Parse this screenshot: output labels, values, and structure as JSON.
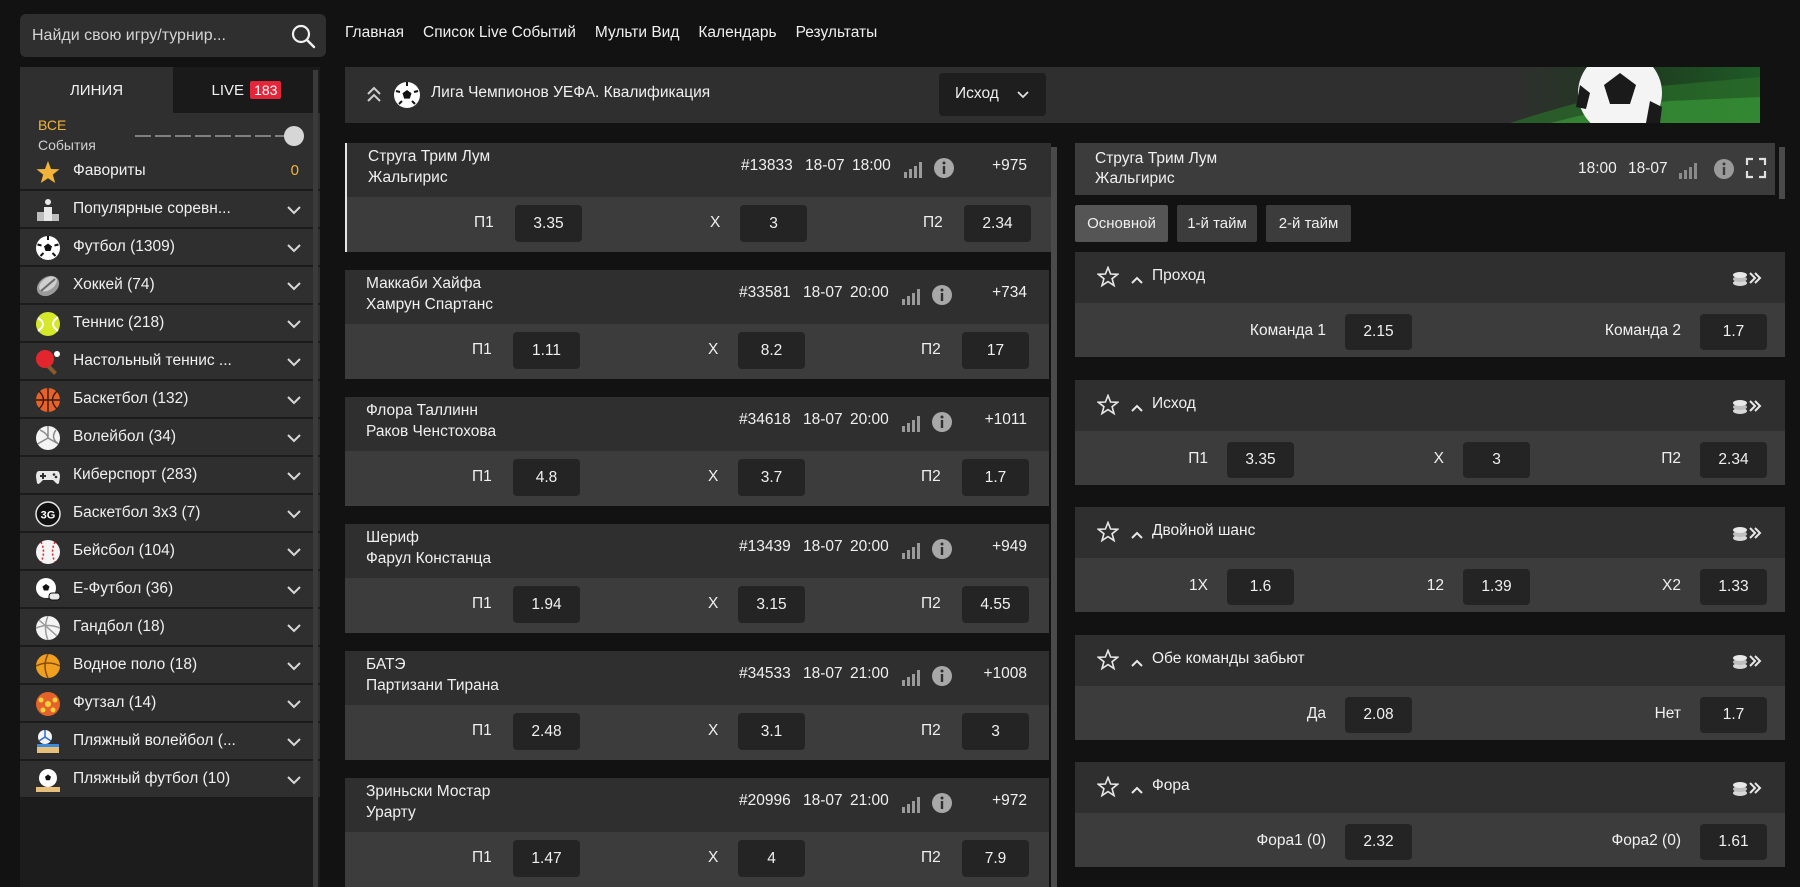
{
  "search": {
    "placeholder": "Найди свою игру/турнир..."
  },
  "topnav": [
    "Главная",
    "Список Live Событий",
    "Мульти Вид",
    "Календарь",
    "Результаты"
  ],
  "sidebar": {
    "tab_line": "ЛИНИЯ",
    "tab_live": "LIVE",
    "live_count": "183",
    "all_label": "ВСЕ",
    "events_label": "События",
    "items": [
      {
        "label": "Фавориты",
        "count": "0",
        "icon": "star-icon"
      },
      {
        "label": "Популярные соревн...",
        "icon": "podium-icon"
      },
      {
        "label": "Футбол (1309)",
        "icon": "soccer-ball-icon"
      },
      {
        "label": "Хоккей (74)",
        "icon": "hockey-puck-icon"
      },
      {
        "label": "Теннис (218)",
        "icon": "tennis-ball-icon"
      },
      {
        "label": "Настольный теннис ...",
        "icon": "table-tennis-icon"
      },
      {
        "label": "Баскетбол (132)",
        "icon": "basketball-icon"
      },
      {
        "label": "Волейбол (34)",
        "icon": "volleyball-icon"
      },
      {
        "label": "Киберспорт (283)",
        "icon": "gamepad-icon"
      },
      {
        "label": "Баскетбол 3х3 (7)",
        "icon": "basketball-3x3-icon"
      },
      {
        "label": "Бейсбол (104)",
        "icon": "baseball-icon"
      },
      {
        "label": "Е-Футбол (36)",
        "icon": "efootball-icon"
      },
      {
        "label": "Гандбол (18)",
        "icon": "handball-icon"
      },
      {
        "label": "Водное поло (18)",
        "icon": "water-polo-icon"
      },
      {
        "label": "Футзал (14)",
        "icon": "futsal-icon"
      },
      {
        "label": "Пляжный волейбол (...",
        "icon": "beach-volleyball-icon"
      },
      {
        "label": "Пляжный футбол (10)",
        "icon": "beach-soccer-icon"
      }
    ]
  },
  "league": {
    "title": "Лига Чемпионов УЕФА. Квалификация",
    "market_select": "Исход"
  },
  "matches": [
    {
      "team1": "Струга Трим Лум",
      "team2": "Жальгирис",
      "id": "#13833",
      "date": "18-07",
      "time": "18:00",
      "more": "+975",
      "o1_label": "П1",
      "o1": "3.35",
      "ox_label": "X",
      "ox": "3",
      "o2_label": "П2",
      "o2": "2.34"
    },
    {
      "team1": "Маккаби Хайфа",
      "team2": "Хамрун Спартанс",
      "id": "#33581",
      "date": "18-07",
      "time": "20:00",
      "more": "+734",
      "o1_label": "П1",
      "o1": "1.11",
      "ox_label": "X",
      "ox": "8.2",
      "o2_label": "П2",
      "o2": "17"
    },
    {
      "team1": "Флора Таллинн",
      "team2": "Раков Ченстохова",
      "id": "#34618",
      "date": "18-07",
      "time": "20:00",
      "more": "+1011",
      "o1_label": "П1",
      "o1": "4.8",
      "ox_label": "X",
      "ox": "3.7",
      "o2_label": "П2",
      "o2": "1.7"
    },
    {
      "team1": "Шериф",
      "team2": "Фарул Констанца",
      "id": "#13439",
      "date": "18-07",
      "time": "20:00",
      "more": "+949",
      "o1_label": "П1",
      "o1": "1.94",
      "ox_label": "X",
      "ox": "3.15",
      "o2_label": "П2",
      "o2": "4.55"
    },
    {
      "team1": "БАТЭ",
      "team2": "Партизани Тирана",
      "id": "#34533",
      "date": "18-07",
      "time": "21:00",
      "more": "+1008",
      "o1_label": "П1",
      "o1": "2.48",
      "ox_label": "X",
      "ox": "3.1",
      "o2_label": "П2",
      "o2": "3"
    },
    {
      "team1": "Зриньски Мостар",
      "team2": "Урарту",
      "id": "#20996",
      "date": "18-07",
      "time": "21:00",
      "more": "+972",
      "o1_label": "П1",
      "o1": "1.47",
      "ox_label": "X",
      "ox": "4",
      "o2_label": "П2",
      "o2": "7.9"
    }
  ],
  "panel": {
    "team1": "Струга Трим Лум",
    "team2": "Жальгирис",
    "time": "18:00",
    "date": "18-07",
    "tabs": [
      "Основной",
      "1-й тайм",
      "2-й тайм"
    ],
    "markets": [
      {
        "name": "Проход",
        "outcomes": [
          {
            "label": "Команда 1",
            "odd": "2.15"
          },
          {
            "label": "Команда 2",
            "odd": "1.7"
          }
        ]
      },
      {
        "name": "Исход",
        "outcomes": [
          {
            "label": "П1",
            "odd": "3.35"
          },
          {
            "label": "X",
            "odd": "3"
          },
          {
            "label": "П2",
            "odd": "2.34"
          }
        ]
      },
      {
        "name": "Двойной шанс",
        "outcomes": [
          {
            "label": "1X",
            "odd": "1.6"
          },
          {
            "label": "12",
            "odd": "1.39"
          },
          {
            "label": "X2",
            "odd": "1.33"
          }
        ]
      },
      {
        "name": "Обе команды забьют",
        "outcomes": [
          {
            "label": "Да",
            "odd": "2.08"
          },
          {
            "label": "Нет",
            "odd": "1.7"
          }
        ]
      },
      {
        "name": "Фора",
        "outcomes": [
          {
            "label": "Фора1 (0)",
            "odd": "2.32"
          },
          {
            "label": "Фора2 (0)",
            "odd": "1.61"
          }
        ]
      }
    ]
  },
  "colors": {
    "accent": "#f2b33a",
    "live_badge": "#e3263a",
    "panel_dark": "#2f2f2f",
    "panel_light": "#3c3c3c",
    "odd_box": "#242424"
  }
}
